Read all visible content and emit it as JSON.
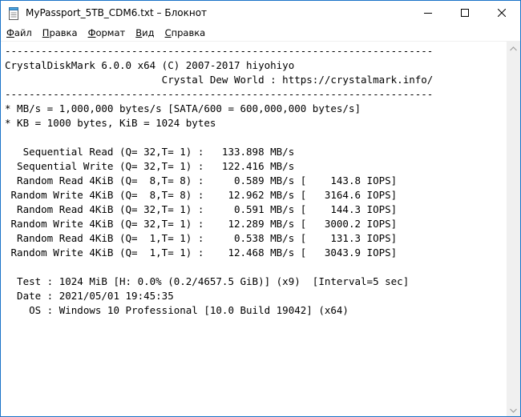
{
  "window": {
    "title": "MyPassport_5TB_CDM6.txt – Блокнот"
  },
  "menu": [
    {
      "mnemonic": "Ф",
      "rest": "айл"
    },
    {
      "mnemonic": "П",
      "rest": "равка"
    },
    {
      "mnemonic": "Ф",
      "rest": "ормат"
    },
    {
      "mnemonic": "В",
      "rest": "ид"
    },
    {
      "mnemonic": "С",
      "rest": "правка"
    }
  ],
  "document": {
    "lines": [
      "-----------------------------------------------------------------------",
      "CrystalDiskMark 6.0.0 x64 (C) 2007-2017 hiyohiyo",
      "                          Crystal Dew World : https://crystalmark.info/",
      "-----------------------------------------------------------------------",
      "* MB/s = 1,000,000 bytes/s [SATA/600 = 600,000,000 bytes/s]",
      "* KB = 1000 bytes, KiB = 1024 bytes",
      "",
      "   Sequential Read (Q= 32,T= 1) :   133.898 MB/s",
      "  Sequential Write (Q= 32,T= 1) :   122.416 MB/s",
      "  Random Read 4KiB (Q=  8,T= 8) :     0.589 MB/s [    143.8 IOPS]",
      " Random Write 4KiB (Q=  8,T= 8) :    12.962 MB/s [   3164.6 IOPS]",
      "  Random Read 4KiB (Q= 32,T= 1) :     0.591 MB/s [    144.3 IOPS]",
      " Random Write 4KiB (Q= 32,T= 1) :    12.289 MB/s [   3000.2 IOPS]",
      "  Random Read 4KiB (Q=  1,T= 1) :     0.538 MB/s [    131.3 IOPS]",
      " Random Write 4KiB (Q=  1,T= 1) :    12.468 MB/s [   3043.9 IOPS]",
      "",
      "  Test : 1024 MiB [H: 0.0% (0.2/4657.5 GiB)] (x9)  [Interval=5 sec]",
      "  Date : 2021/05/01 19:45:35",
      "    OS : Windows 10 Professional [10.0 Build 19042] (x64)"
    ]
  },
  "icons": {
    "app": "notepad-icon",
    "minimize": "minimize-icon",
    "maximize": "maximize-icon",
    "close": "close-icon",
    "scroll_up": "chevron-up-icon",
    "scroll_down": "chevron-down-icon"
  },
  "colors": {
    "window_border": "#1a73c8",
    "scrollbar": "#f0f0f0",
    "text": "#000000"
  }
}
